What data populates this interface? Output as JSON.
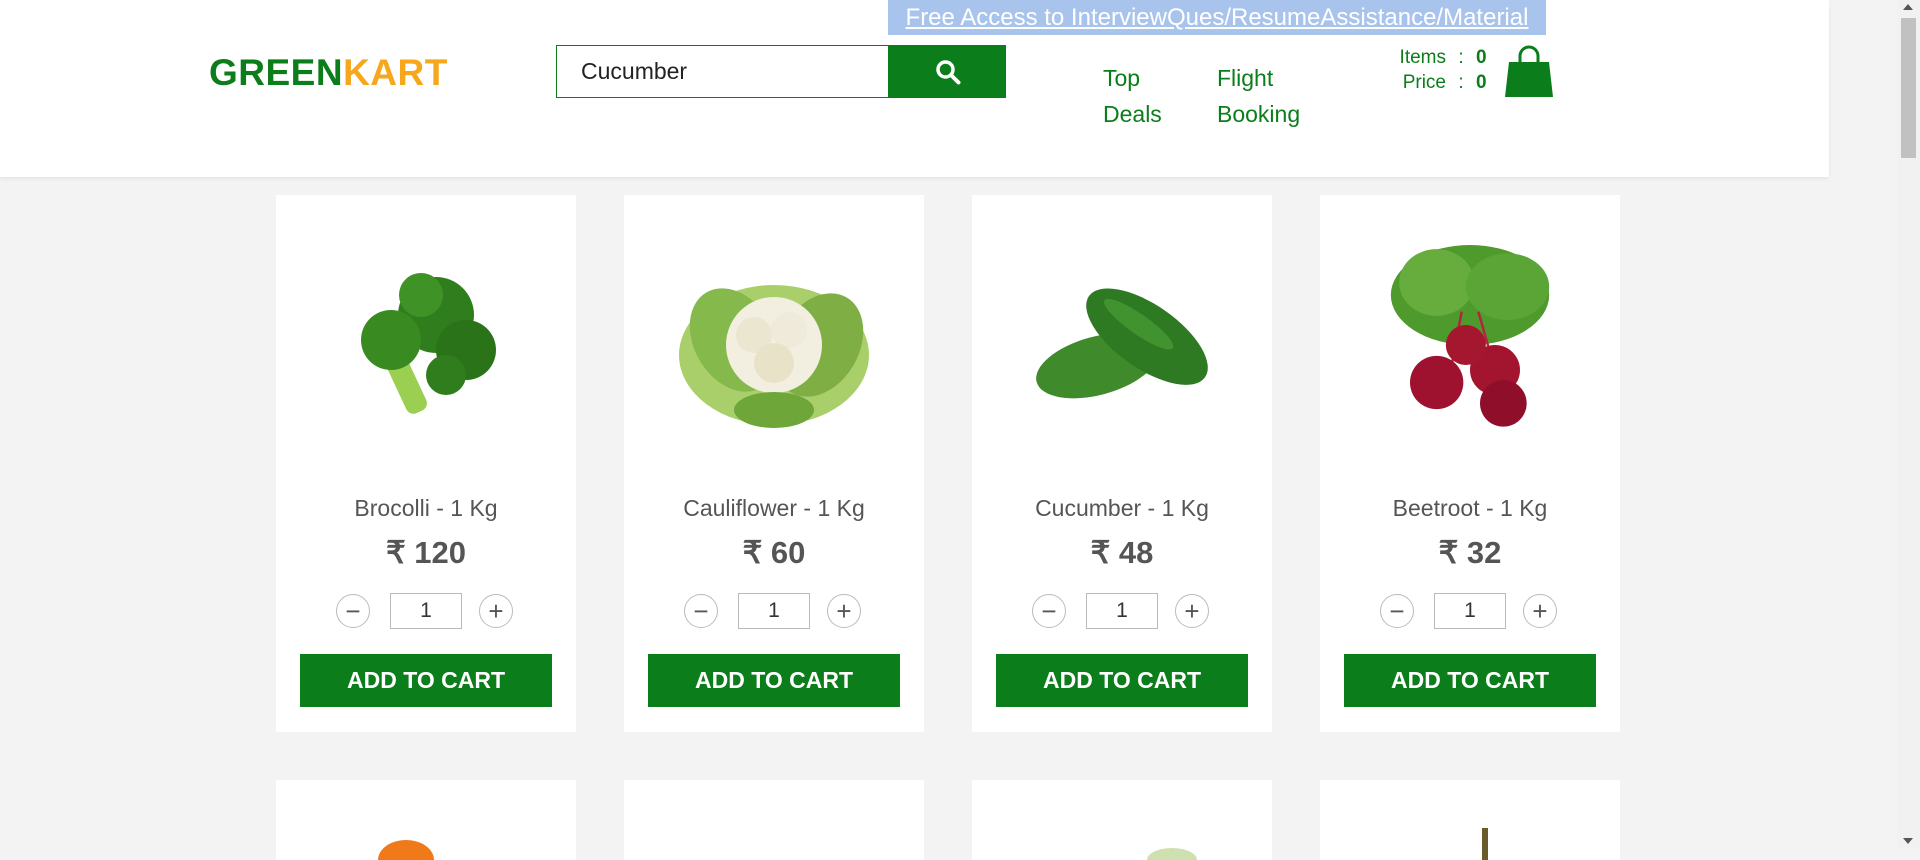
{
  "promo": {
    "text": "Free Access to InterviewQues/ResumeAssistance/Material"
  },
  "logo": {
    "part1": "GREEN",
    "part2": "KART"
  },
  "search": {
    "value": "Cucumber",
    "icon": "search-icon"
  },
  "nav": {
    "top_deals": "Top Deals",
    "flight_booking": "Flight Booking"
  },
  "cart": {
    "items_label": "Items",
    "items_value": "0",
    "price_label": "Price",
    "price_value": "0",
    "separator": ":",
    "icon": "shopping-bag-icon"
  },
  "colors": {
    "brand_green": "#0b7d1a",
    "brand_orange": "#f6a71c",
    "promo_bg": "#a9c4ec"
  },
  "products": [
    {
      "name": "Brocolli - 1 Kg",
      "price": "₹ 120",
      "qty": "1",
      "add_label": "ADD TO CART",
      "minus": "−",
      "plus": "+"
    },
    {
      "name": "Cauliflower - 1 Kg",
      "price": "₹ 60",
      "qty": "1",
      "add_label": "ADD TO CART",
      "minus": "−",
      "plus": "+"
    },
    {
      "name": "Cucumber - 1 Kg",
      "price": "₹ 48",
      "qty": "1",
      "add_label": "ADD TO CART",
      "minus": "−",
      "plus": "+"
    },
    {
      "name": "Beetroot - 1 Kg",
      "price": "₹ 32",
      "qty": "1",
      "add_label": "ADD TO CART",
      "minus": "−",
      "plus": "+"
    }
  ]
}
